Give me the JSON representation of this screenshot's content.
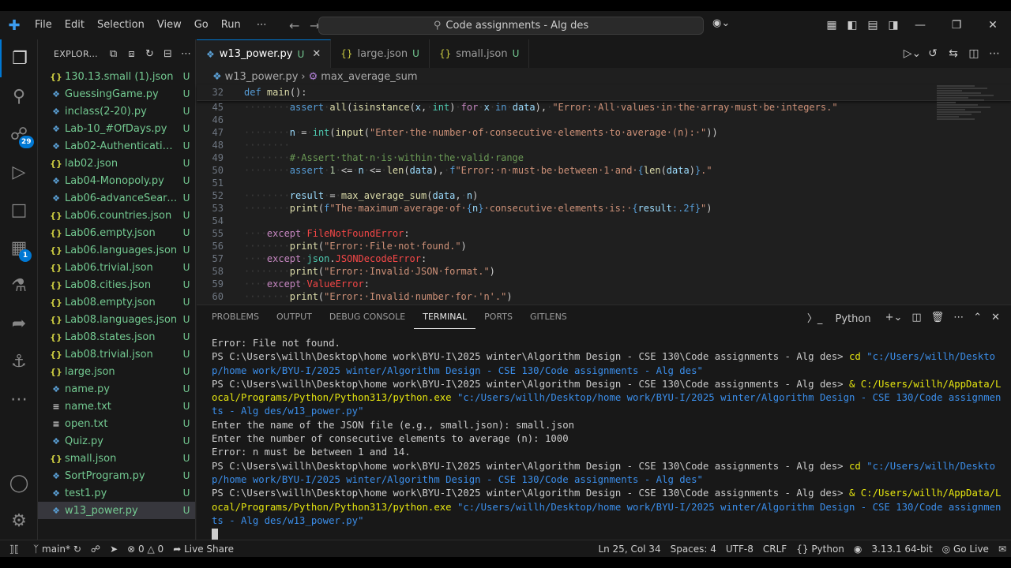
{
  "title_bar": {
    "menu": [
      "File",
      "Edit",
      "Selection",
      "View",
      "Go",
      "Run"
    ],
    "command_center": "Code assignments - Alg des"
  },
  "activity_bar": {
    "source_control_badge": "29",
    "extensions_badge": "1"
  },
  "explorer": {
    "title": "EXPLOR...",
    "files": [
      {
        "name": "130.13.small (1).json",
        "kind": "json",
        "status": "U"
      },
      {
        "name": "GuessingGame.py",
        "kind": "py",
        "status": "U"
      },
      {
        "name": "inclass(2-20).py",
        "kind": "py",
        "status": "U"
      },
      {
        "name": "Lab-10_#OfDays.py",
        "kind": "py",
        "status": "U"
      },
      {
        "name": "Lab02-Authentication....",
        "kind": "py",
        "status": "U"
      },
      {
        "name": "lab02.json",
        "kind": "json",
        "status": "U"
      },
      {
        "name": "Lab04-Monopoly.py",
        "kind": "py",
        "status": "U"
      },
      {
        "name": "Lab06-advanceSearch...",
        "kind": "py",
        "status": "U"
      },
      {
        "name": "Lab06.countries.json",
        "kind": "json",
        "status": "U"
      },
      {
        "name": "Lab06.empty.json",
        "kind": "json",
        "status": "U"
      },
      {
        "name": "Lab06.languages.json",
        "kind": "json",
        "status": "U"
      },
      {
        "name": "Lab06.trivial.json",
        "kind": "json",
        "status": "U"
      },
      {
        "name": "Lab08.cities.json",
        "kind": "json",
        "status": "U"
      },
      {
        "name": "Lab08.empty.json",
        "kind": "json",
        "status": "U"
      },
      {
        "name": "Lab08.languages.json",
        "kind": "json",
        "status": "U"
      },
      {
        "name": "Lab08.states.json",
        "kind": "json",
        "status": "U"
      },
      {
        "name": "Lab08.trivial.json",
        "kind": "json",
        "status": "U"
      },
      {
        "name": "large.json",
        "kind": "json",
        "status": "U"
      },
      {
        "name": "name.py",
        "kind": "py",
        "status": "U"
      },
      {
        "name": "name.txt",
        "kind": "txt",
        "status": "U"
      },
      {
        "name": "open.txt",
        "kind": "txt",
        "status": "U"
      },
      {
        "name": "Quiz.py",
        "kind": "py",
        "status": "U"
      },
      {
        "name": "small.json",
        "kind": "json",
        "status": "U"
      },
      {
        "name": "SortProgram.py",
        "kind": "py",
        "status": "U"
      },
      {
        "name": "test1.py",
        "kind": "py",
        "status": "U"
      },
      {
        "name": "w13_power.py",
        "kind": "py",
        "status": "U",
        "selected": true
      }
    ]
  },
  "tabs": [
    {
      "name": "w13_power.py",
      "status": "U",
      "active": true
    },
    {
      "name": "large.json",
      "status": "U"
    },
    {
      "name": "small.json",
      "status": "U"
    }
  ],
  "breadcrumb": {
    "file": "w13_power.py",
    "symbol": "max_average_sum"
  },
  "editor": {
    "sticky_line_number": "32",
    "sticky_code": "def main():",
    "line_numbers": [
      "45",
      "46",
      "47",
      "48",
      "49",
      "50",
      "51",
      "52",
      "53",
      "54",
      "55",
      "56",
      "57",
      "58",
      "59",
      "60"
    ]
  },
  "panel": {
    "tabs": [
      "PROBLEMS",
      "OUTPUT",
      "DEBUG CONSOLE",
      "TERMINAL",
      "PORTS",
      "GITLENS"
    ],
    "active_tab": "TERMINAL",
    "terminal_profile": "Python",
    "terminal_lines": [
      "Error: File not found.",
      "PS C:\\Users\\willh\\Desktop\\home work\\BYU-I\\2025 winter\\Algorithm Design - CSE 130\\Code assignments - Alg des> cd \"c:/Users/willh/Desktop/home work/BYU-I/2025 winter/Algorithm Design - CSE 130/Code assignments - Alg des\"",
      "PS C:\\Users\\willh\\Desktop\\home work\\BYU-I\\2025 winter\\Algorithm Design - CSE 130\\Code assignments - Alg des> & C:/Users/willh/AppData/Local/Programs/Python/Python313/python.exe \"c:/Users/willh/Desktop/home work/BYU-I/2025 winter/Algorithm Design - CSE 130/Code assignments - Alg des/w13_power.py\"",
      "Enter the name of the JSON file (e.g., small.json): small.json",
      "Enter the number of consecutive elements to average (n): 1000",
      "Error: n must be between 1 and 14.",
      "PS C:\\Users\\willh\\Desktop\\home work\\BYU-I\\2025 winter\\Algorithm Design - CSE 130\\Code assignments - Alg des> cd \"c:/Users/willh/Desktop/home work/BYU-I/2025 winter/Algorithm Design - CSE 130/Code assignments - Alg des\"",
      "PS C:\\Users\\willh\\Desktop\\home work\\BYU-I\\2025 winter\\Algorithm Design - CSE 130\\Code assignments - Alg des> & C:/Users/willh/AppData/Local/Programs/Python/Python313/python.exe \"c:/Users/willh/Desktop/home work/BYU-I/2025 winter/Algorithm Design - CSE 130/Code assignments - Alg des/w13_power.py\""
    ]
  },
  "status_bar": {
    "branch": "main*",
    "errors": "0",
    "warnings": "0",
    "live_share": "Live Share",
    "cursor_pos": "Ln 25, Col 34",
    "spaces": "Spaces: 4",
    "encoding": "UTF-8",
    "eol": "CRLF",
    "language": "Python",
    "interpreter": "3.13.1 64-bit",
    "go_live": "Go Live"
  },
  "colors": {
    "accent": "#0078d4",
    "untracked": "#73c991",
    "background": "#1f1f1f"
  }
}
